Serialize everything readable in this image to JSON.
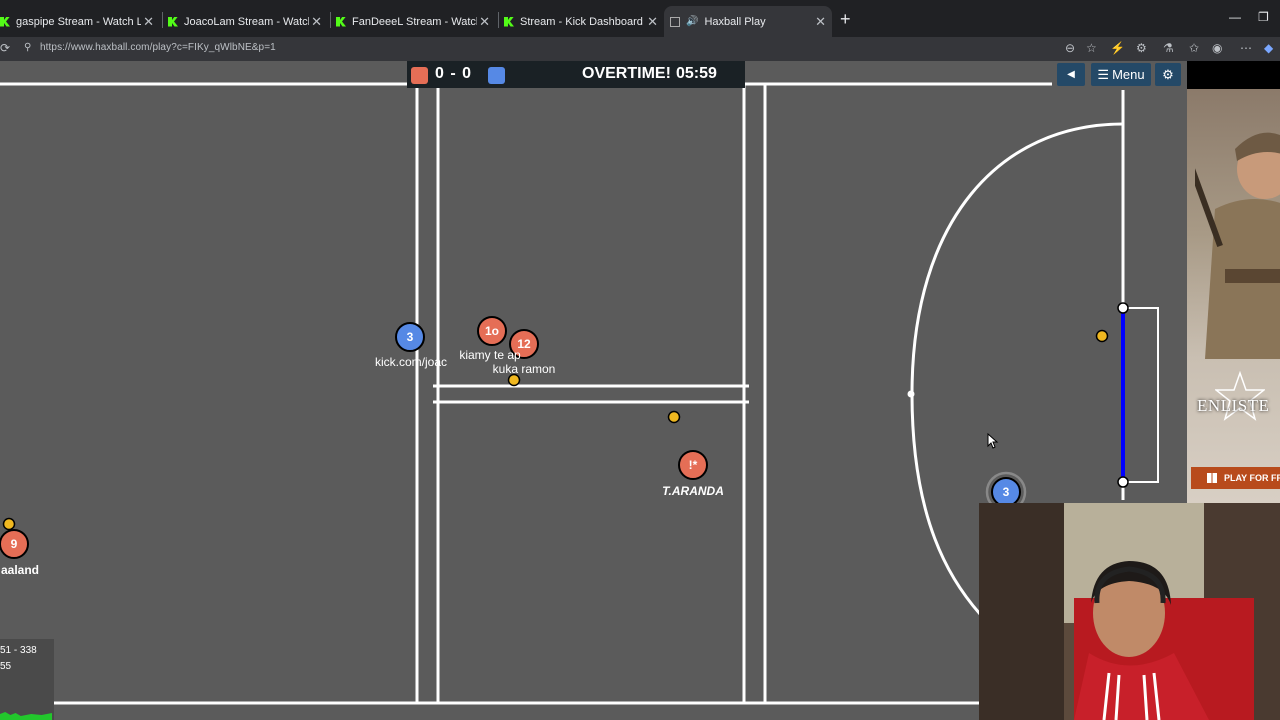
{
  "browser": {
    "tabs": [
      {
        "title": "gaspipe Stream - Watch Live on Ki",
        "icon": "kick-icon"
      },
      {
        "title": "JoacoLam Stream - Watch Live on",
        "icon": "kick-icon"
      },
      {
        "title": "FanDeeeL Stream - Watch Live on",
        "icon": "kick-icon"
      },
      {
        "title": "Stream - Kick Dashboard",
        "icon": "kick-icon"
      },
      {
        "title": "Haxball Play",
        "icon": "haxball-icon",
        "active": true
      }
    ],
    "url": "https://www.haxball.com/play?c=FIKy_qWlbNE&p=1"
  },
  "scoreboard": {
    "red_score": "0",
    "separator": "-",
    "blue_score": "0",
    "score_text": "0 - 0",
    "status": "OVERTIME!",
    "time": "05:59",
    "red_color": "#e56e56",
    "blue_color": "#5689e5"
  },
  "controls": {
    "sound_icon": "speaker-icon",
    "menu_label": "Menu",
    "settings_icon": "gear-icon"
  },
  "players": [
    {
      "number": "3",
      "team": "blue",
      "name": "kick.com/joac"
    },
    {
      "number": "1o",
      "team": "red",
      "name": "kiamy te ap"
    },
    {
      "number": "12",
      "team": "red",
      "name": "kuka ramon"
    },
    {
      "number": "!*",
      "team": "red",
      "name": "T.ARANDA"
    },
    {
      "number": "9",
      "team": "red",
      "name": "aaland"
    },
    {
      "number": "3",
      "team": "blue",
      "name": ""
    }
  ],
  "stats": {
    "line1": "51 - 338",
    "line2": "55"
  },
  "ad": {
    "brand": "ENLISTE",
    "button": "PLAY FOR FR"
  }
}
